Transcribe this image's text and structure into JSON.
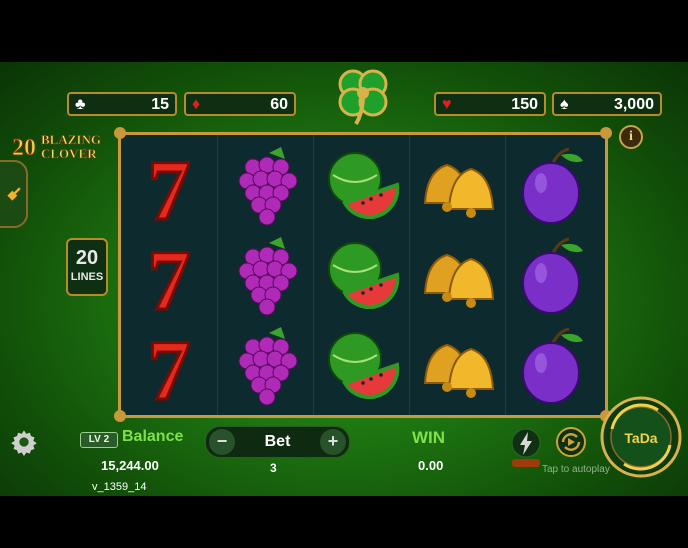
{
  "counters": [
    {
      "suit": "club",
      "glyph": "♣",
      "color": "#ffffff",
      "value": "15"
    },
    {
      "suit": "diamond",
      "glyph": "♦",
      "color": "#e02020",
      "value": "60"
    },
    {
      "suit": "heart",
      "glyph": "♥",
      "color": "#e02020",
      "value": "150"
    },
    {
      "suit": "spade",
      "glyph": "♠",
      "color": "#ffffff",
      "value": "3,000"
    }
  ],
  "logo": {
    "number": "20",
    "line1": "BLAZING",
    "line2": "CLOVER"
  },
  "info_glyph": "i",
  "lines": {
    "number": "20",
    "label": "LINES"
  },
  "reels": {
    "columns": [
      "seven",
      "grapes",
      "watermelon",
      "bells",
      "plum"
    ],
    "rows": 3
  },
  "player": {
    "level": "LV 2",
    "balance_label": "Balance",
    "balance_value": "15,244.00"
  },
  "bet": {
    "label": "Bet",
    "minus": "−",
    "plus": "+",
    "value": "3"
  },
  "win": {
    "label": "WIN",
    "value": "0.00"
  },
  "autoplay_hint": "Tap to autoplay",
  "spin_label": "TaDa",
  "version": "v_1359_14",
  "colors": {
    "accent_green": "#7fe04a",
    "gold": "#c8983a",
    "reel_bg": "#0d2a2e"
  }
}
